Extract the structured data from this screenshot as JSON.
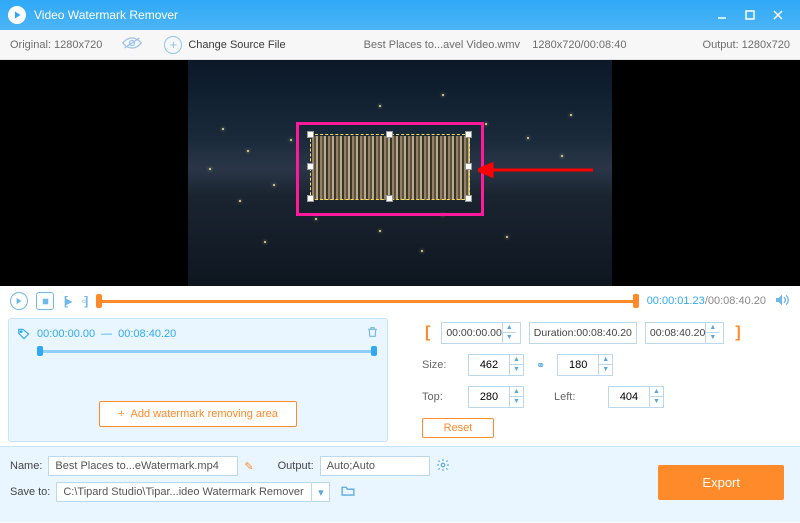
{
  "app": {
    "title": "Video Watermark Remover"
  },
  "infobar": {
    "original_label": "Original:",
    "original_res": "1280x720",
    "change_source": "Change Source File",
    "filename": "Best Places to...avel Video.wmv",
    "file_meta": "1280x720/00:08:40",
    "output_label": "Output:",
    "output_res": "1280x720"
  },
  "playbar": {
    "current": "00:00:01.23",
    "sep": "/",
    "total": "00:08:40.20"
  },
  "segment": {
    "start": "00:00:00.00",
    "dash": "—",
    "end": "00:08:40.20",
    "add_label": "Add watermark removing area"
  },
  "params": {
    "time_start": "00:00:00.00",
    "duration_label": "Duration:",
    "duration": "00:08:40.20",
    "time_end": "00:08:40.20",
    "size_label": "Size:",
    "width": "462",
    "height": "180",
    "top_label": "Top:",
    "top": "280",
    "left_label": "Left:",
    "left": "404",
    "reset": "Reset"
  },
  "bottom": {
    "name_label": "Name:",
    "name_value": "Best Places to...eWatermark.mp4",
    "output_label": "Output:",
    "output_value": "Auto;Auto",
    "save_label": "Save to:",
    "save_value": "C:\\Tipard Studio\\Tipar...ideo Watermark Remover",
    "export": "Export"
  }
}
